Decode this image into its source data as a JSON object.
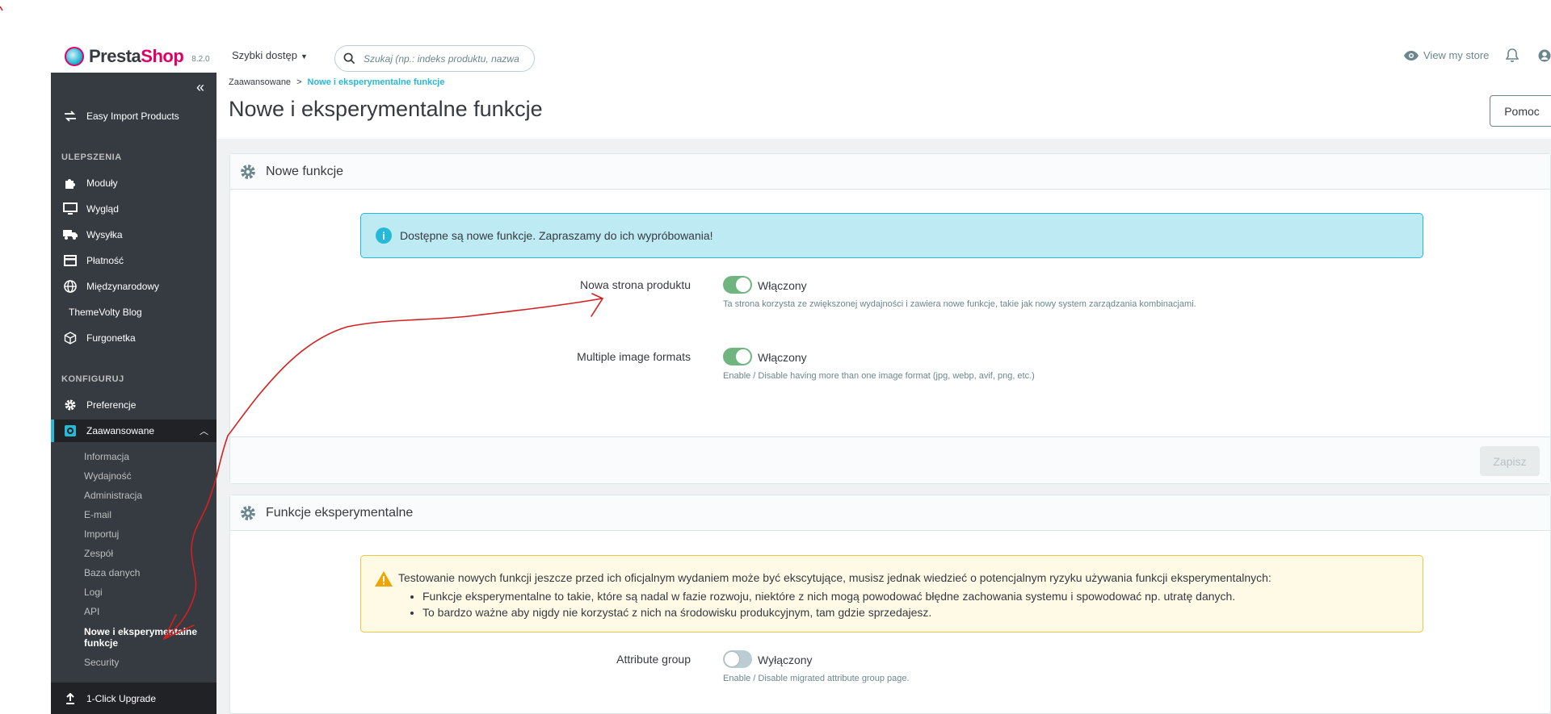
{
  "header": {
    "logo_main": "Presta",
    "logo_accent": "Shop",
    "version": "8.2.0",
    "quick_access": "Szybki dostęp",
    "search_placeholder": "Szukaj (np.: indeks produktu, nazwa k",
    "view_store": "View my store"
  },
  "sidebar": {
    "top_item": "Easy Import Products",
    "section_improvements": "ULEPSZENIA",
    "improvements": [
      {
        "label": "Moduły",
        "icon": "puzzle-icon"
      },
      {
        "label": "Wygląd",
        "icon": "monitor-icon"
      },
      {
        "label": "Wysyłka",
        "icon": "truck-icon"
      },
      {
        "label": "Płatność",
        "icon": "credit-card-icon"
      },
      {
        "label": "Międzynarodowy",
        "icon": "globe-icon"
      },
      {
        "label": "ThemeVolty Blog",
        "icon": ""
      },
      {
        "label": "Furgonetka",
        "icon": "box-icon"
      }
    ],
    "section_configure": "KONFIGURUJ",
    "configure": [
      {
        "label": "Preferencje",
        "icon": "gear-icon"
      },
      {
        "label": "Zaawansowane",
        "icon": "settings-box-icon"
      }
    ],
    "sub_items": [
      "Informacja",
      "Wydajność",
      "Administracja",
      "E-mail",
      "Importuj",
      "Zespół",
      "Baza danych",
      "Logi",
      "API",
      "Nowe i eksperymentalne funkcje",
      "Security"
    ],
    "bottom_item": "1-Click Upgrade"
  },
  "breadcrumb": {
    "parent": "Zaawansowane",
    "separator": ">",
    "current": "Nowe i eksperymentalne funkcje"
  },
  "page": {
    "title": "Nowe i eksperymentalne funkcje",
    "help_button": "Pomoc"
  },
  "new_features": {
    "title": "Nowe funkcje",
    "alert": "Dostępne są nowe funkcje. Zapraszamy do ich wypróbowania!",
    "features": [
      {
        "label": "Nowa strona produktu",
        "state": "Włączony",
        "enabled": true,
        "help": "Ta strona korzysta ze zwiększonej wydajności i zawiera nowe funkcje, takie jak nowy system zarządzania kombinacjami."
      },
      {
        "label": "Multiple image formats",
        "state": "Włączony",
        "enabled": true,
        "help": "Enable / Disable having more than one image format (jpg, webp, avif, png, etc.)"
      }
    ],
    "save_button": "Zapisz"
  },
  "experimental": {
    "title": "Funkcje eksperymentalne",
    "warning": "Testowanie nowych funkcji jeszcze przed ich oficjalnym wydaniem może być ekscytujące, musisz jednak wiedzieć o potencjalnym ryzyku używania funkcji eksperymentalnych:",
    "warning_points": [
      "Funkcje eksperymentalne to takie, które są nadal w fazie rozwoju, niektóre z nich mogą powodować błędne zachowania systemu i spowodować np. utratę danych.",
      "To bardzo ważne aby nigdy nie korzystać z nich na środowisku produkcyjnym, tam gdzie sprzedajesz."
    ],
    "features": [
      {
        "label": "Attribute group",
        "state": "Wyłączony",
        "enabled": false,
        "help": "Enable / Disable migrated attribute group page."
      }
    ]
  },
  "colors": {
    "sidebar_bg": "#363a41",
    "accent": "#25b9d7",
    "brand": "#df0067",
    "switch_on": "#70b580",
    "annotation": "#d42020"
  }
}
